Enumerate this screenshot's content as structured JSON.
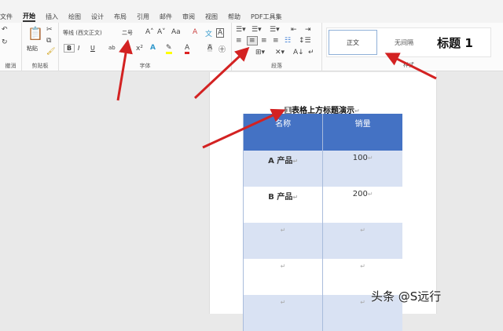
{
  "tabs": [
    "文件",
    "开始",
    "插入",
    "绘图",
    "设计",
    "布局",
    "引用",
    "邮件",
    "审阅",
    "视图",
    "帮助",
    "PDF工具集"
  ],
  "active_tab": "开始",
  "ribbon": {
    "undo_label": "撤消",
    "clipboard": {
      "paste": "粘贴",
      "label": "剪贴板"
    },
    "font": {
      "name": "等线 (西文正文)",
      "size": "二号",
      "label": "字体",
      "bold": "B",
      "italic": "I",
      "underline": "U"
    },
    "paragraph": {
      "label": "段落"
    },
    "styles": {
      "items": [
        "正文",
        "无间隔",
        "标题 1"
      ],
      "label": "样式"
    }
  },
  "document": {
    "caption_number": "1",
    "caption_text": "表格上方标题演示",
    "para_mark": "↵",
    "table": {
      "headers": [
        "名称",
        "销量"
      ],
      "rows": [
        [
          "A 产品",
          "100"
        ],
        [
          "B 产品",
          "200"
        ],
        [
          "",
          ""
        ],
        [
          "",
          ""
        ],
        [
          "",
          ""
        ]
      ]
    }
  },
  "watermark": "头条 @S远行",
  "colors": {
    "header": "#4472c4",
    "band": "#d9e2f3",
    "arrow": "#d32222"
  }
}
